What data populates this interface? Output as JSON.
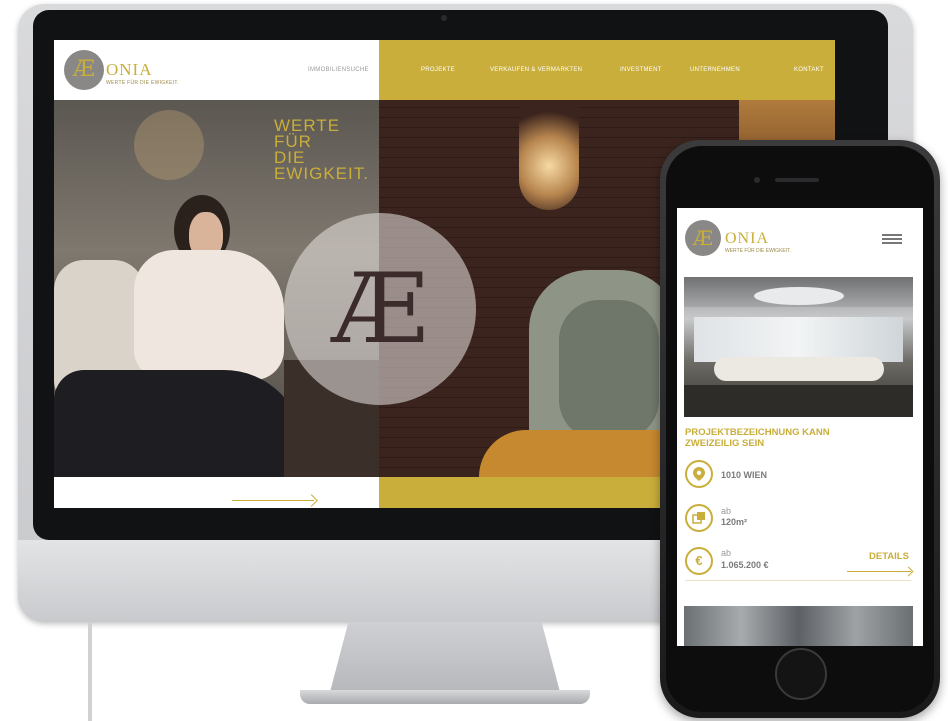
{
  "desktop": {
    "logo": {
      "mark": "Æ",
      "word": "ONIA",
      "tagline": "WERTE FÜR DIE EWIGKEIT."
    },
    "nav": [
      {
        "label": "IMMOBILIENSUCHE"
      },
      {
        "label": "PROJEKTE"
      },
      {
        "label": "VERKAUFEN & VERMARKTEN"
      },
      {
        "label": "INVESTMENT"
      },
      {
        "label": "UNTERNEHMEN"
      },
      {
        "label": "KONTAKT"
      }
    ],
    "hero": {
      "tagline_lines": [
        "WERTE",
        "FÜR",
        "DIE",
        "EWIGKEIT."
      ],
      "emblem": "Æ"
    }
  },
  "mobile": {
    "logo": {
      "mark": "Æ",
      "word": "ONIA",
      "tagline": "WERTE FÜR DIE EWIGKEIT."
    },
    "project": {
      "title": "PROJEKTBEZEICHNUNG KANN ZWEIZEILIG SEIN",
      "location": "1010 WIEN",
      "area_prefix": "ab",
      "area": "120m²",
      "price_prefix": "ab",
      "price": "1.065.200 €",
      "details_label": "DETAILS"
    },
    "icons": {
      "location": "map-pin-icon",
      "area": "area-icon",
      "price": "euro-icon"
    },
    "glyphs": {
      "price": "€"
    }
  },
  "colors": {
    "accent": "#c9ae3b",
    "logo_circle": "#8a8886"
  }
}
